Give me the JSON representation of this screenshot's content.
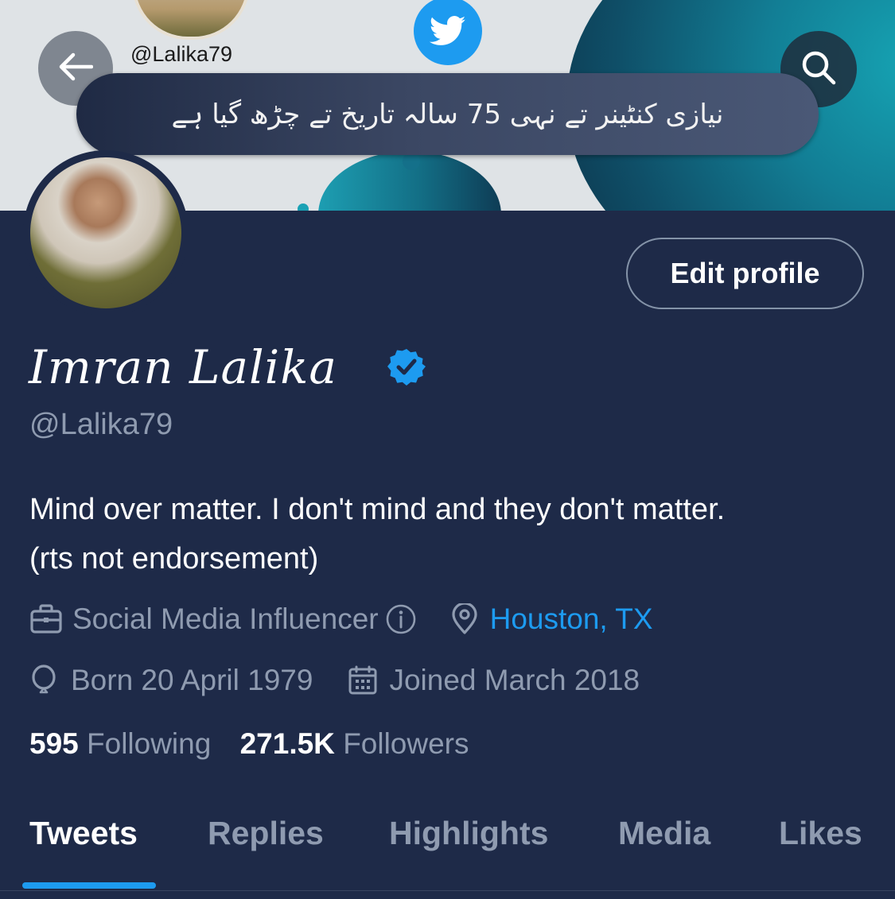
{
  "banner": {
    "handle_small": "@Lalika79",
    "urdu_text": "نیازی کنٹینر تے نہی 75 سالہ تاریخ تے چڑھ گیا ہے"
  },
  "toolbar": {
    "back_icon": "arrow-left-icon",
    "search_icon": "search-icon"
  },
  "profile": {
    "display_name": "Imran Lalika",
    "verified": true,
    "handle": "@Lalika79",
    "edit_label": "Edit profile",
    "bio_line1": "Mind over matter. I don't mind and they don't matter.",
    "bio_line2": "(rts not endorsement)",
    "category": "Social Media Influencer",
    "location": "Houston, TX",
    "born": "Born 20 April 1979",
    "joined": "Joined March 2018",
    "following_count": "595",
    "following_label": "Following",
    "followers_count": "271.5K",
    "followers_label": "Followers"
  },
  "tabs": [
    {
      "label": "Tweets",
      "active": true
    },
    {
      "label": "Replies",
      "active": false
    },
    {
      "label": "Highlights",
      "active": false
    },
    {
      "label": "Media",
      "active": false
    },
    {
      "label": "Likes",
      "active": false
    }
  ],
  "colors": {
    "background": "#1e2a48",
    "accent": "#1d9bf0",
    "muted_text": "#8f9bb0"
  }
}
